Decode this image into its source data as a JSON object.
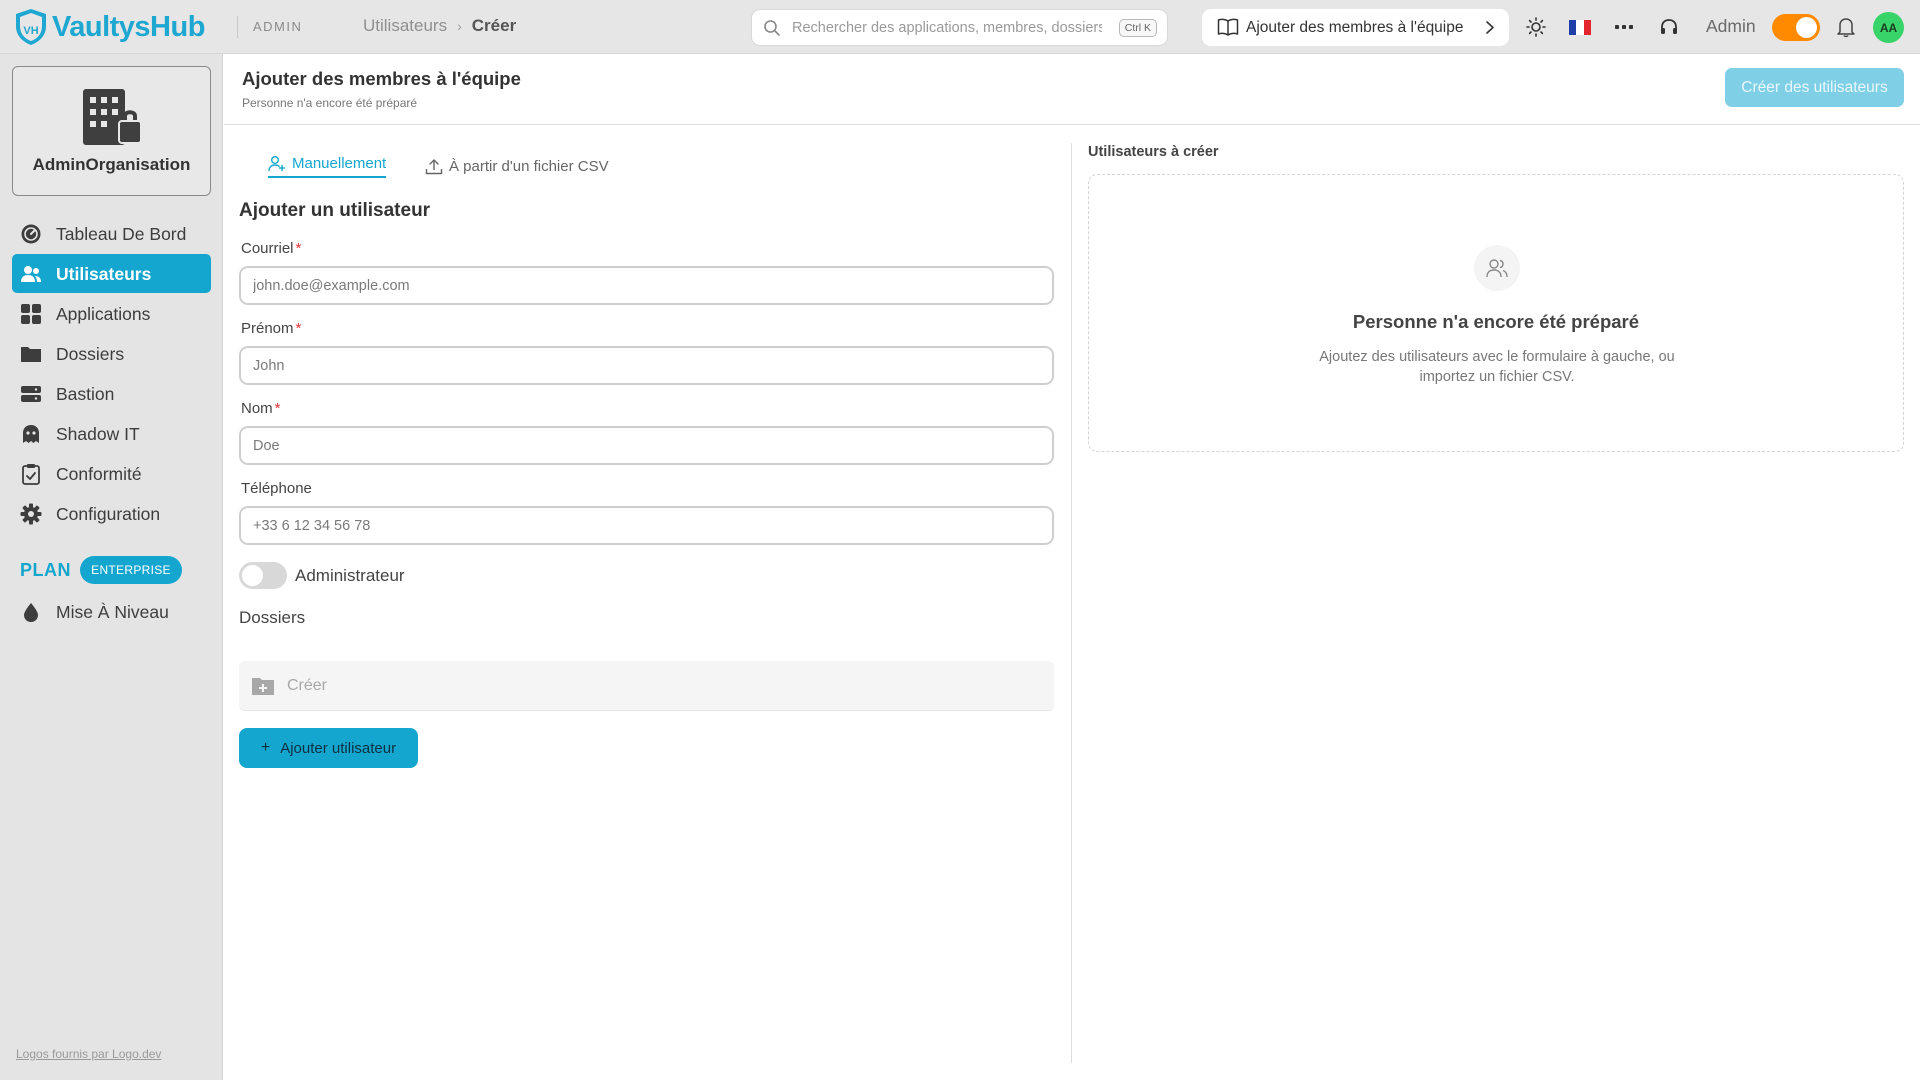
{
  "app": {
    "name": "VaultysHub",
    "section_tag": "ADMIN"
  },
  "breadcrumb": {
    "parent": "Utilisateurs",
    "separator": "›",
    "current": "Créer"
  },
  "search": {
    "placeholder": "Rechercher des applications, membres, dossiers...",
    "shortcut": "Ctrl K"
  },
  "guide": {
    "label": "Ajouter des membres à l'équipe"
  },
  "topbar": {
    "admin_label": "Admin",
    "admin_mode_on": true,
    "avatar_initials": "AA",
    "avatar_color": "#38d46a",
    "accent_color": "#ff8a00"
  },
  "sidebar": {
    "org_name": "AdminOrganisation",
    "items": [
      {
        "label": "Tableau De Bord",
        "icon": "dashboard-icon",
        "active": false
      },
      {
        "label": "Utilisateurs",
        "icon": "users-icon",
        "active": true
      },
      {
        "label": "Applications",
        "icon": "apps-grid-icon",
        "active": false
      },
      {
        "label": "Dossiers",
        "icon": "folder-icon",
        "active": false
      },
      {
        "label": "Bastion",
        "icon": "server-icon",
        "active": false
      },
      {
        "label": "Shadow IT",
        "icon": "ghost-icon",
        "active": false
      },
      {
        "label": "Conformité",
        "icon": "clipboard-check-icon",
        "active": false
      },
      {
        "label": "Configuration",
        "icon": "gear-icon",
        "active": false
      }
    ],
    "plan_label": "PLAN",
    "plan_badge": "ENTERPRISE",
    "upgrade_label": "Mise À Niveau",
    "logos_credit": "Logos fournis par Logo.dev",
    "brand_color": "#14a6cf"
  },
  "header": {
    "title": "Ajouter des membres à l'équipe",
    "subtitle": "Personne n'a encore été préparé",
    "create_button": "Créer des utilisateurs"
  },
  "tabs": [
    {
      "label": "Manuellement",
      "active": true
    },
    {
      "label": "À partir d'un fichier CSV",
      "active": false
    }
  ],
  "form": {
    "title": "Ajouter un utilisateur",
    "email": {
      "label": "Courriel",
      "required": "*",
      "placeholder": "john.doe@example.com",
      "value": ""
    },
    "firstname": {
      "label": "Prénom",
      "required": "*",
      "placeholder": "John",
      "value": ""
    },
    "lastname": {
      "label": "Nom",
      "required": "*",
      "placeholder": "Doe",
      "value": ""
    },
    "phone": {
      "label": "Téléphone",
      "placeholder": "+33 6 12 34 56 78",
      "value": ""
    },
    "admin_toggle": {
      "label": "Administrateur",
      "on": false
    },
    "folders": {
      "label": "Dossiers",
      "create_label": "Créer"
    },
    "submit": {
      "plus": "+",
      "label": "Ajouter utilisateur"
    }
  },
  "users_panel": {
    "title": "Utilisateurs à créer",
    "empty_title": "Personne n'a encore été préparé",
    "empty_desc": "Ajoutez des utilisateurs avec le formulaire à gauche, ou importez un fichier CSV."
  }
}
